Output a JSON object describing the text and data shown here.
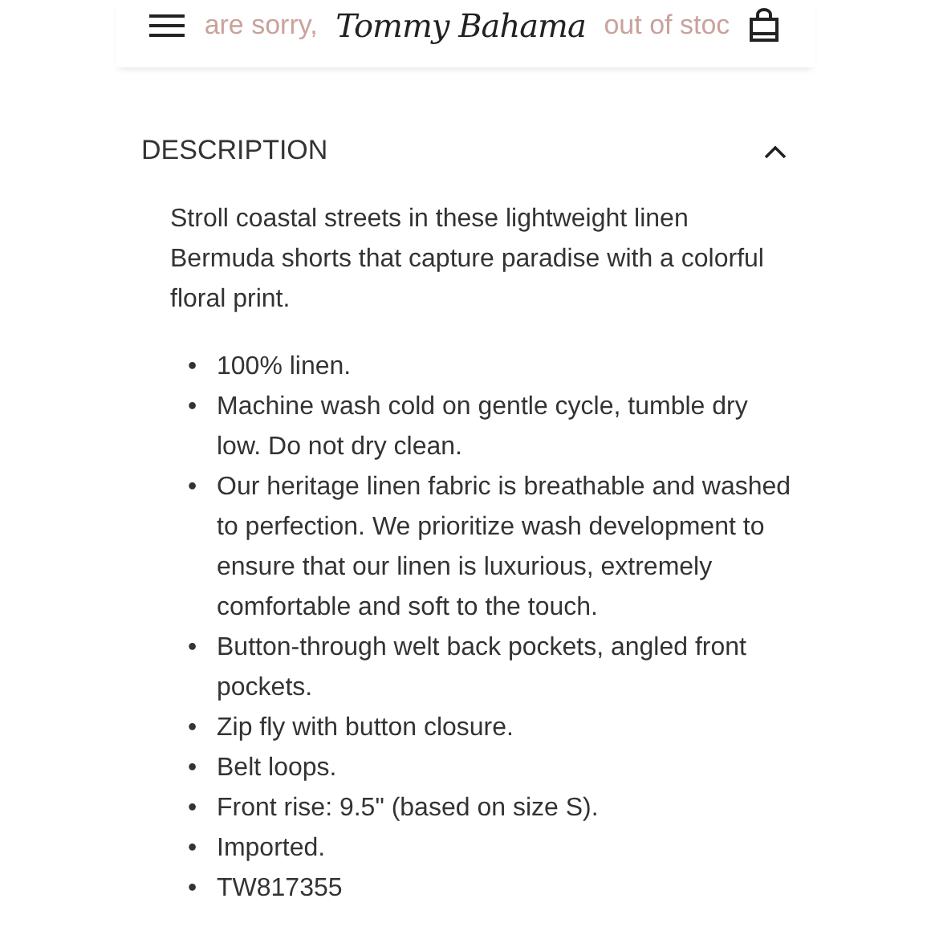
{
  "header": {
    "logo": "Tommy Bahama",
    "banner_fragments": [
      "are sorry,",
      "out of stoc"
    ]
  },
  "section": {
    "title": "DESCRIPTION",
    "expanded": true,
    "intro": "Stroll coastal streets in these lightweight linen Bermuda shorts that capture paradise with a colorful floral print.",
    "bullets": [
      {
        "marker": "•",
        "text": "100% linen."
      },
      {
        "marker": "•",
        "text": "Machine wash cold on gentle cycle, tumble dry low. Do not dry clean."
      },
      {
        "marker": "•",
        "text": "Our heritage linen fabric is breathable and washed to perfection. We prioritize wash development to ensure that our linen is luxurious, extremely comfortable and soft to the touch."
      },
      {
        "marker": "•",
        "text": "Button-through welt back pockets, angled front pockets."
      },
      {
        "marker": "•",
        "text": "Zip fly with button closure."
      },
      {
        "marker": "•",
        "text": "Belt loops."
      },
      {
        "marker": "•",
        "text": "Front rise: 9.5\" (based on size S)."
      },
      {
        "marker": "•",
        "text": "Imported."
      },
      {
        "marker": "•",
        "text": "TW817355"
      }
    ]
  }
}
